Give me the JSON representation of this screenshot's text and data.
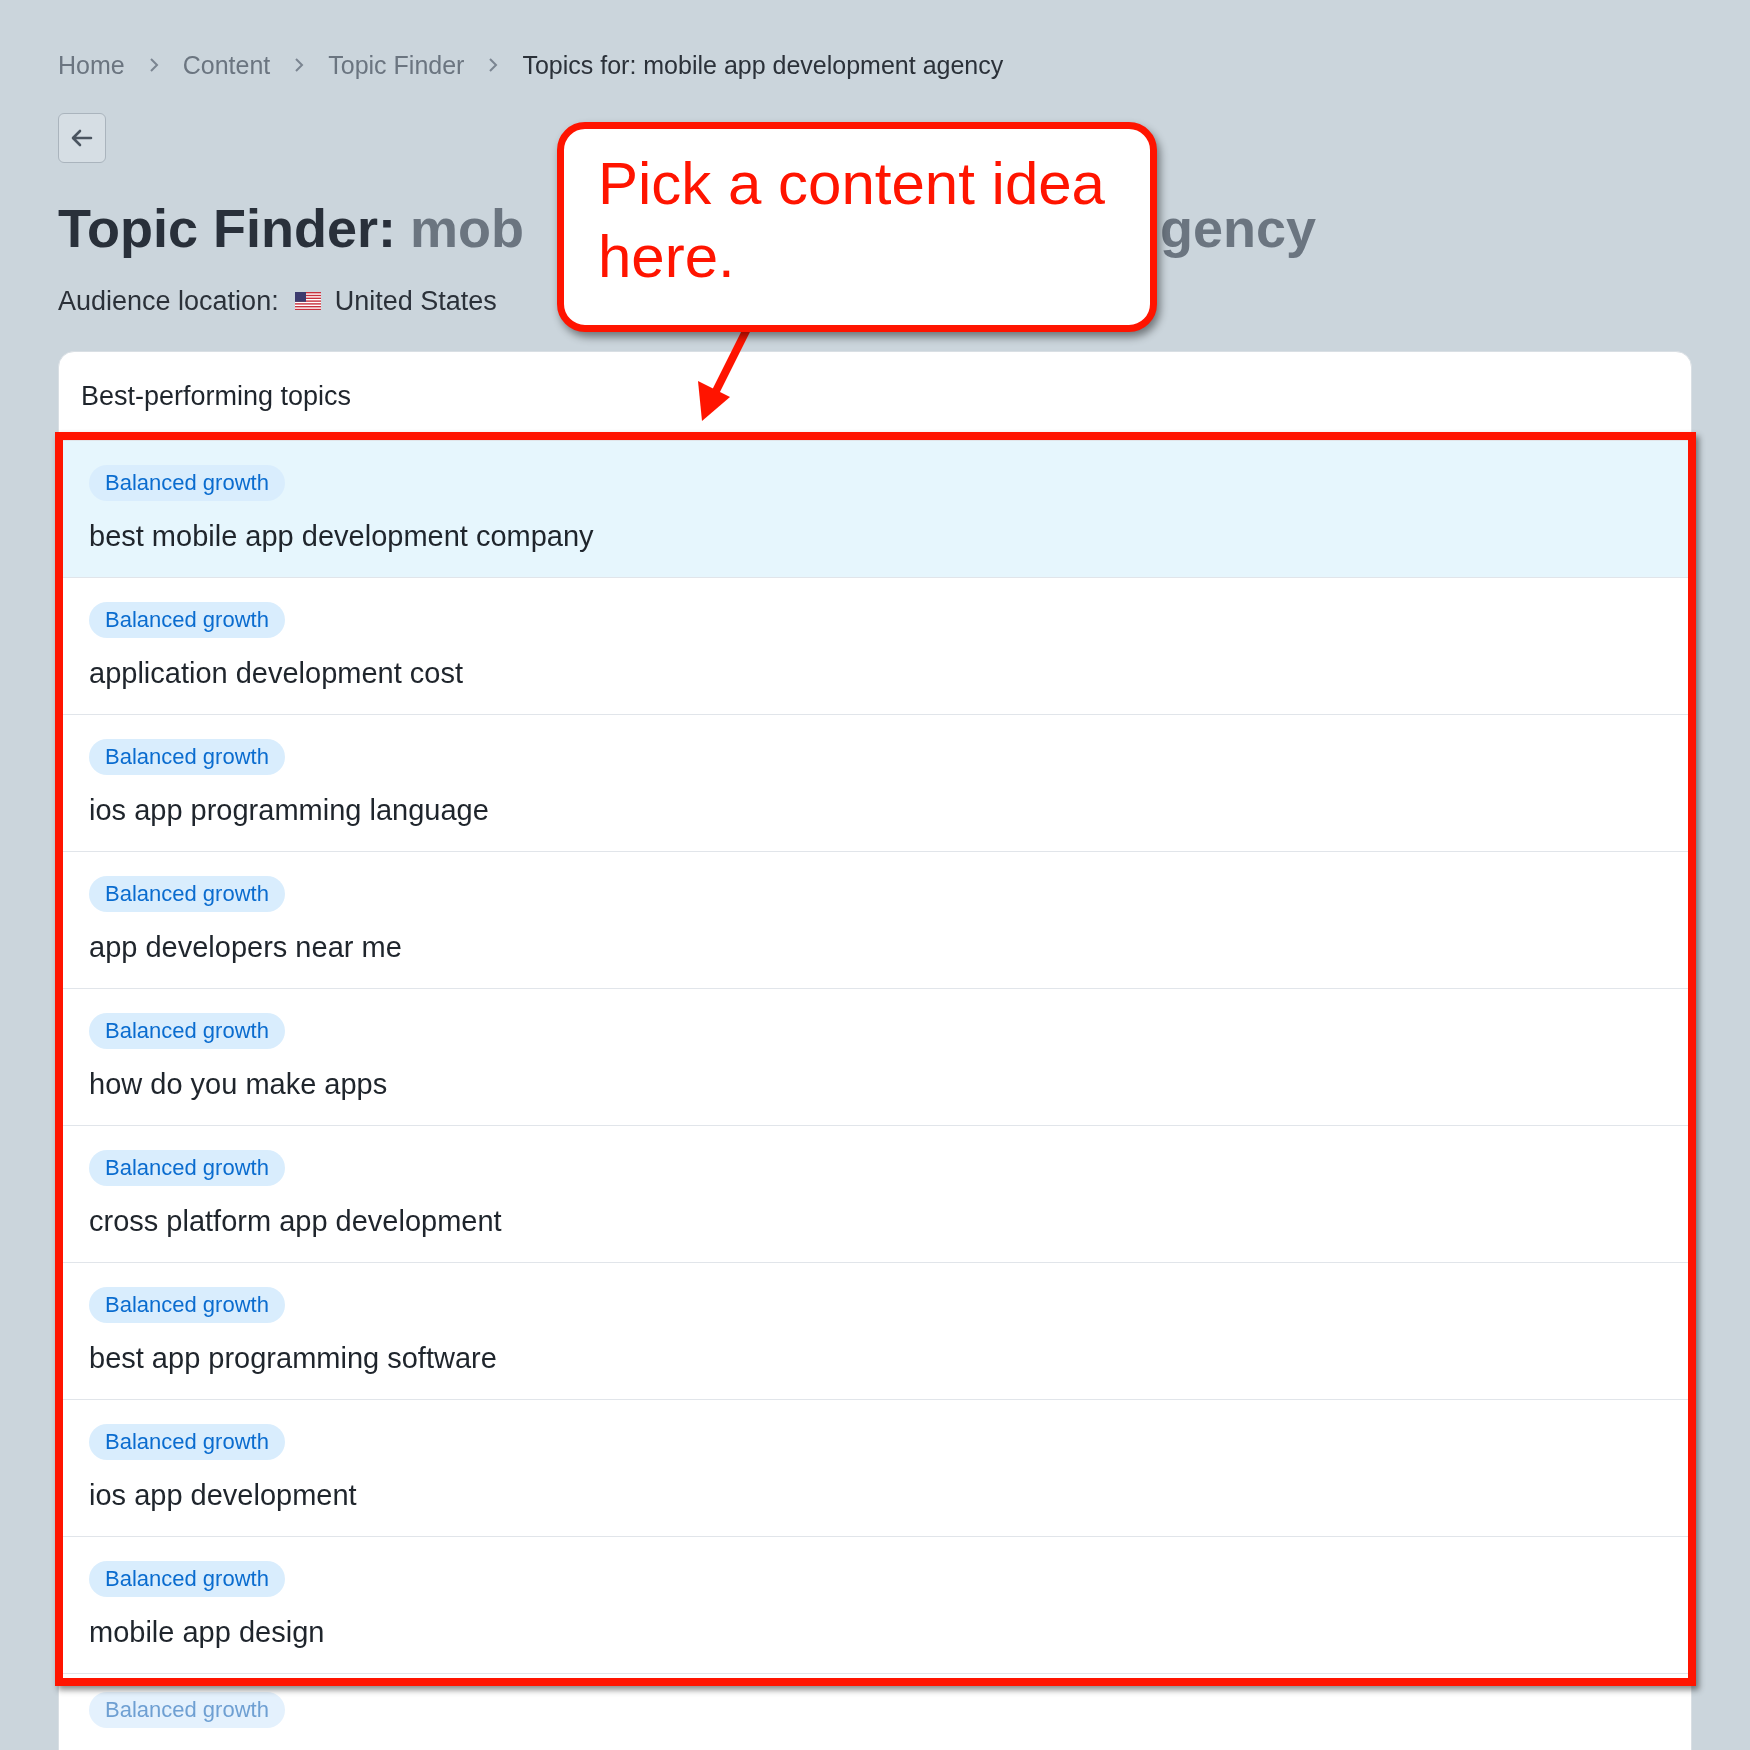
{
  "breadcrumb": [
    {
      "label": "Home",
      "current": false
    },
    {
      "label": "Content",
      "current": false
    },
    {
      "label": "Topic Finder",
      "current": false
    },
    {
      "label": "Topics for: mobile app development agency",
      "current": true
    }
  ],
  "title": {
    "prefix": "Topic Finder:",
    "subject_visible_start": "mob",
    "subject_visible_end": "gency"
  },
  "audience": {
    "label": "Audience location:",
    "country": "United States"
  },
  "card": {
    "heading": "Best-performing topics",
    "rows": [
      {
        "tag": "Balanced growth",
        "topic": "best mobile app development company",
        "selected": true
      },
      {
        "tag": "Balanced growth",
        "topic": "application development cost",
        "selected": false
      },
      {
        "tag": "Balanced growth",
        "topic": "ios app programming language",
        "selected": false
      },
      {
        "tag": "Balanced growth",
        "topic": "app developers near me",
        "selected": false
      },
      {
        "tag": "Balanced growth",
        "topic": "how do you make apps",
        "selected": false
      },
      {
        "tag": "Balanced growth",
        "topic": "cross platform app development",
        "selected": false
      },
      {
        "tag": "Balanced growth",
        "topic": "best app programming software",
        "selected": false
      },
      {
        "tag": "Balanced growth",
        "topic": "ios app development",
        "selected": false
      },
      {
        "tag": "Balanced growth",
        "topic": "mobile app design",
        "selected": false
      }
    ],
    "faded_tag": "Balanced growth"
  },
  "annotation": {
    "callout": "Pick a content idea here."
  }
}
